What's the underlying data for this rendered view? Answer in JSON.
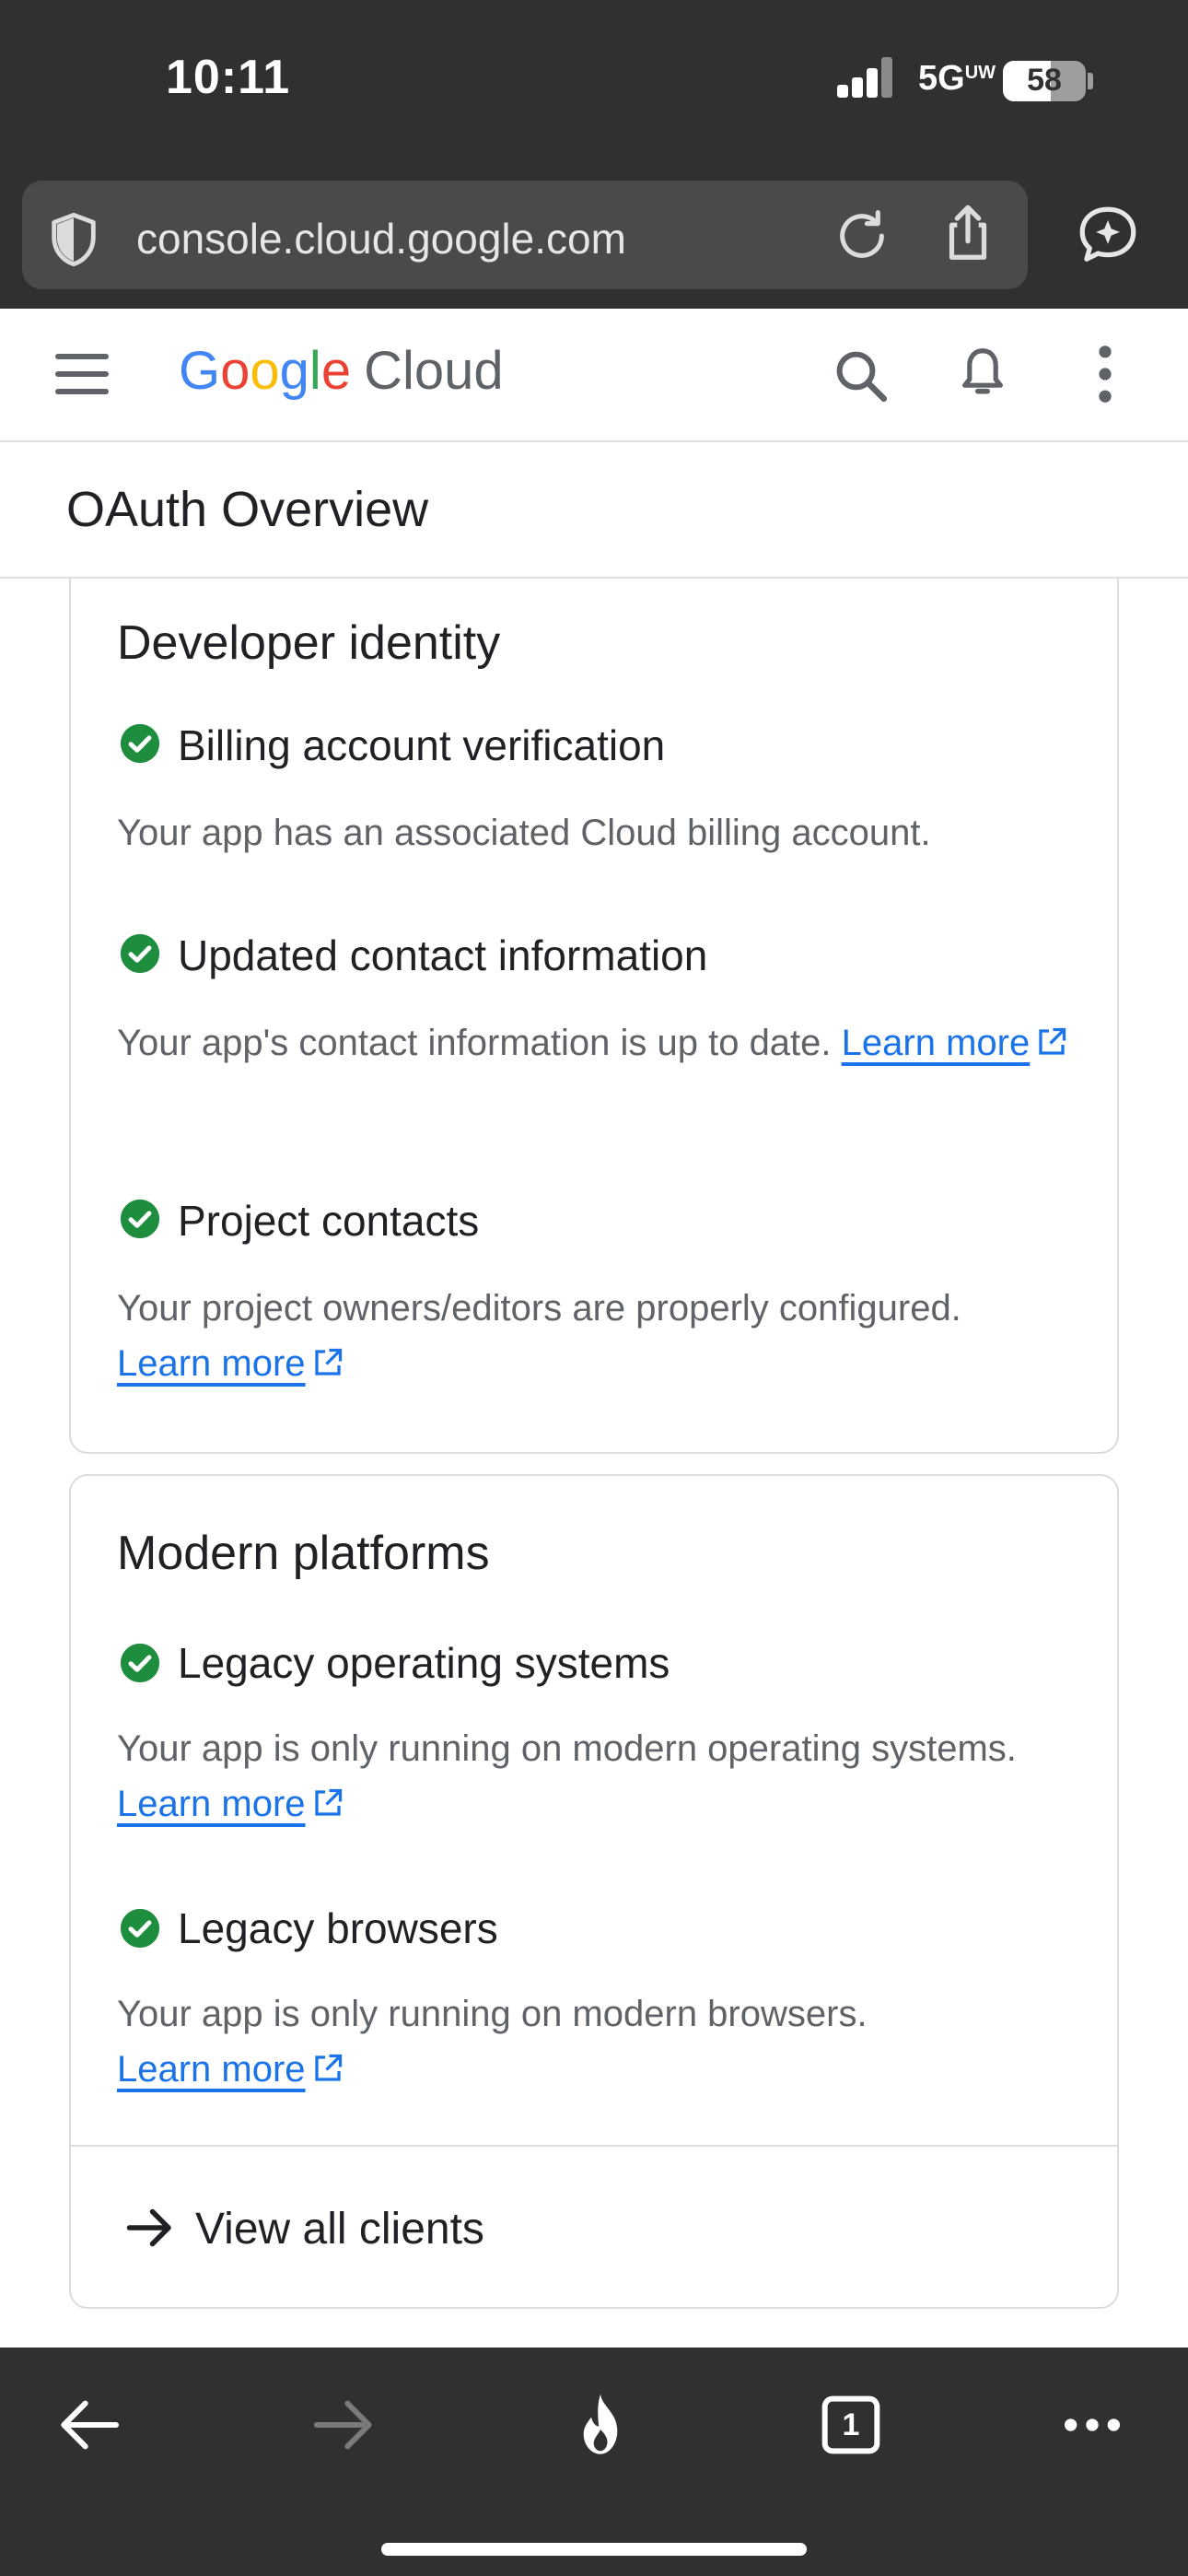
{
  "status": {
    "time": "10:11",
    "network": "5G",
    "network_suffix": "UW",
    "battery": "58",
    "battery_level": 0.58
  },
  "browser": {
    "url": "console.cloud.google.com"
  },
  "header": {
    "logo_letters": [
      "G",
      "o",
      "o",
      "g",
      "l",
      "e"
    ],
    "logo_product": "Cloud",
    "colors": {
      "blue": "#4285F4",
      "red": "#EA4335",
      "yellow": "#FBBC05",
      "green": "#34A853"
    }
  },
  "page": {
    "title": "OAuth Overview"
  },
  "cards": [
    {
      "title": "Developer identity",
      "items": [
        {
          "title": "Billing account verification",
          "desc": "Your app has an associated Cloud billing account."
        },
        {
          "title": "Updated contact information",
          "desc": "Your app's contact information is up to date.",
          "link": "Learn more"
        },
        {
          "title": "Project contacts",
          "desc": "Your project owners/editors are properly configured.",
          "link": "Learn more"
        }
      ]
    },
    {
      "title": "Modern platforms",
      "items": [
        {
          "title": "Legacy operating systems",
          "desc": "Your app is only running on modern operating systems.",
          "link": "Learn more"
        },
        {
          "title": "Legacy browsers",
          "desc": "Your app is only running on modern browsers.",
          "link": "Learn more"
        }
      ],
      "footer_action": "View all clients"
    }
  ],
  "toolbar": {
    "tab_count": "1"
  },
  "theme": {
    "success": "#1e8e3e",
    "link": "#1a73e8",
    "chrome": "#303030"
  }
}
